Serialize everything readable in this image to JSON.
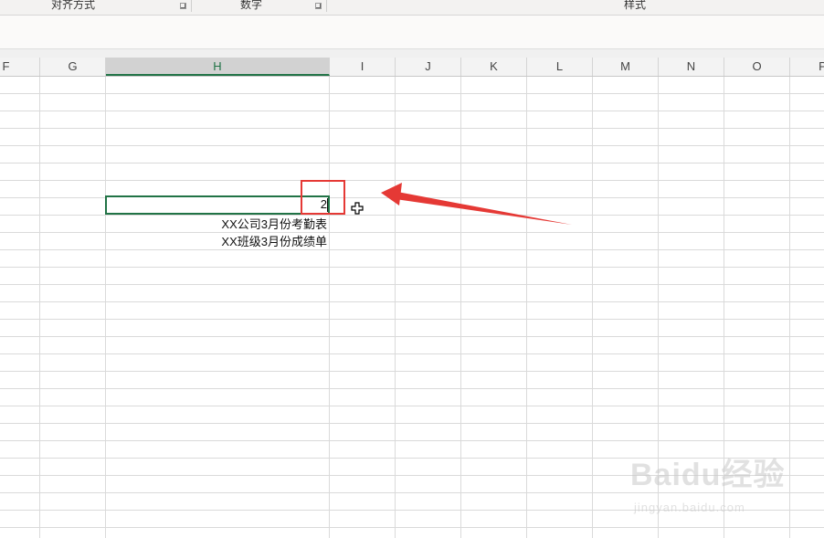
{
  "ribbon": {
    "groups": [
      {
        "label": "对齐方式"
      },
      {
        "label": "数字"
      },
      {
        "label": "样式"
      }
    ]
  },
  "columns": [
    "F",
    "G",
    "H",
    "I",
    "J",
    "K",
    "L",
    "M",
    "N",
    "O",
    "P"
  ],
  "selected_column": "H",
  "cells": {
    "active_value": "2",
    "row1_text": "XX公司3月份考勤表",
    "row2_text": "XX班级3月份成绩单"
  },
  "watermark": {
    "logo": "Baidu经验",
    "url": "jingyan.baidu.com"
  },
  "colors": {
    "accent_green": "#217346",
    "annotation_red": "#e53935"
  },
  "icons": {
    "cursor": "fill-handle-cross-cursor",
    "launcher": "dialog-launcher-icon",
    "arrow": "annotation-arrow"
  }
}
